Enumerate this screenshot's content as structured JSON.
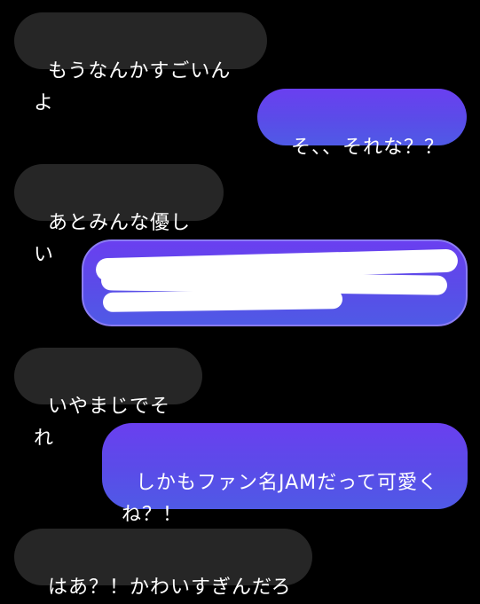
{
  "messages": [
    {
      "id": "m1",
      "side": "received",
      "text": "もうなんかすごいんよ"
    },
    {
      "id": "m2",
      "side": "sent",
      "text": "そ、、それな？？"
    },
    {
      "id": "m3",
      "side": "received",
      "text": "あとみんな優しい"
    },
    {
      "id": "m4",
      "side": "sent",
      "text": "",
      "redacted": true
    },
    {
      "id": "m5",
      "side": "received",
      "text": "いやまじでそれ"
    },
    {
      "id": "m6",
      "side": "sent",
      "text": "しかもファン名JAMだって可愛く\nね？！"
    },
    {
      "id": "m7",
      "side": "received",
      "text": "はあ？！かわいすぎんだろ"
    }
  ],
  "colors": {
    "background": "#000000",
    "received_bubble": "#262626",
    "sent_bubble_top": "#6a3ff0",
    "sent_bubble_bottom": "#4f5ae6",
    "text": "#ffffff",
    "redaction": "#ffffff"
  }
}
